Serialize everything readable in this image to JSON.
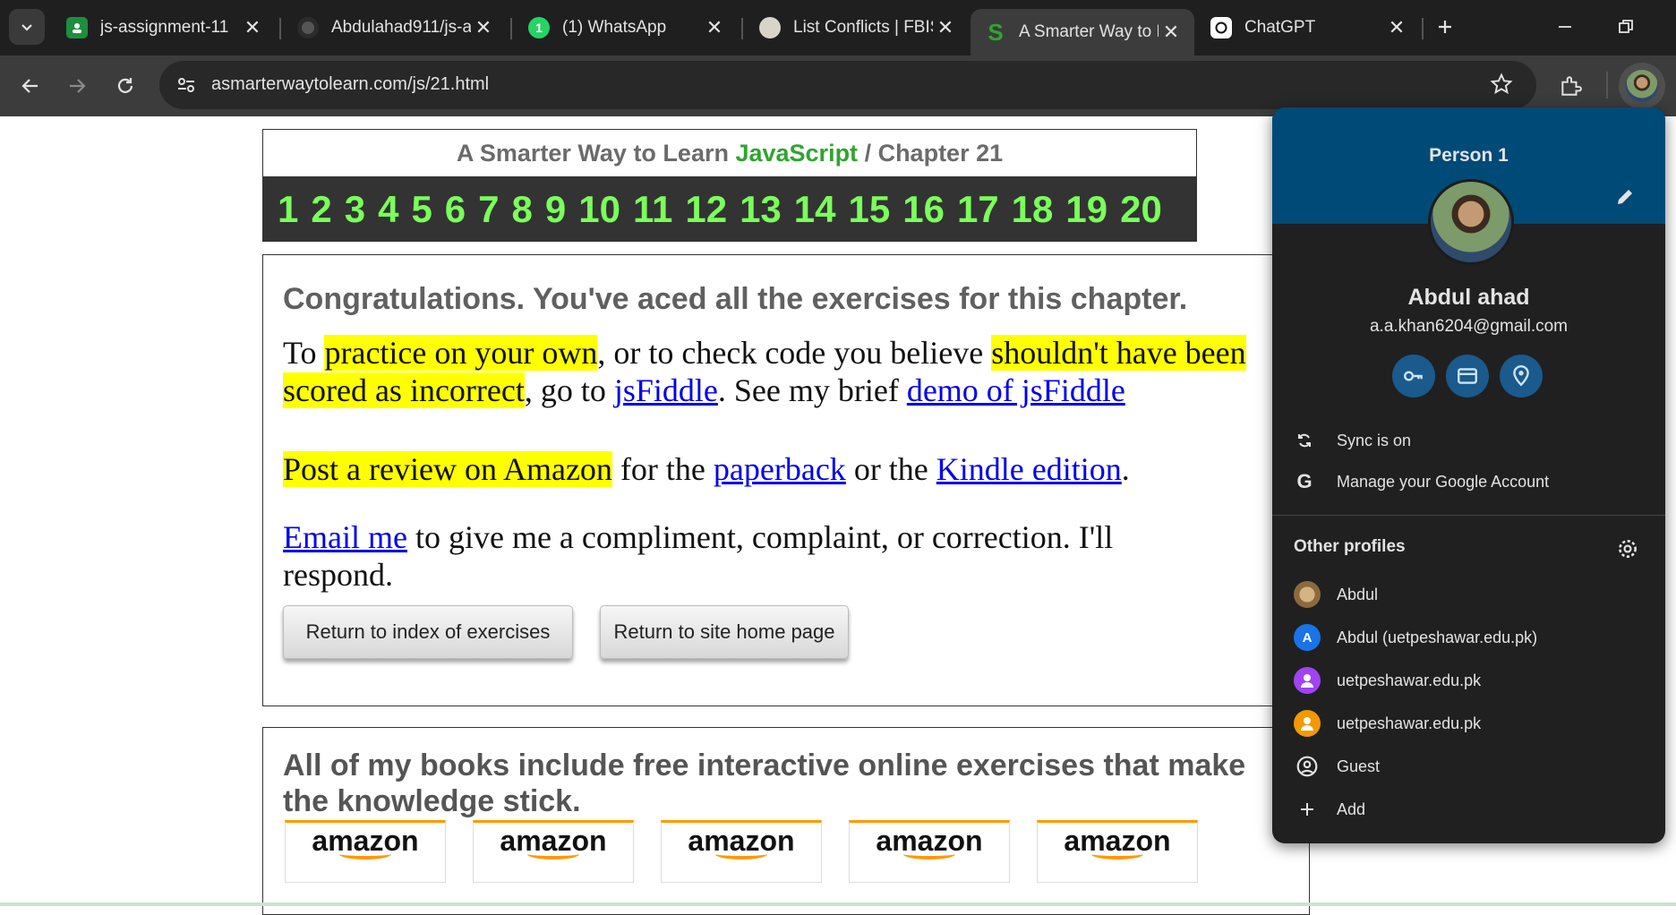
{
  "tabs": [
    {
      "title": "js-assignment-11",
      "icon": "classroom-icon",
      "color": "#1e8e3e"
    },
    {
      "title": "Abdulahad911/js-a",
      "icon": "github-icon",
      "color": "#2b2b2b"
    },
    {
      "title": "(1) WhatsApp",
      "icon": "whatsapp-icon",
      "color": "#25d366"
    },
    {
      "title": "List Conflicts | FBIS",
      "icon": "fbis-icon",
      "color": "#d9d4c8"
    },
    {
      "title": "A Smarter Way to L",
      "icon": "smarterway-icon",
      "color": "#2fa52f"
    },
    {
      "title": "ChatGPT",
      "icon": "chatgpt-icon",
      "color": "#ffffff"
    }
  ],
  "toolbar": {
    "url": "asmarterwaytolearn.com/js/21.html"
  },
  "page": {
    "header_prefix": "A Smarter Way to Learn ",
    "header_js": "JavaScript",
    "header_suffix": " / Chapter 21",
    "chapters": [
      "1",
      "2",
      "3",
      "4",
      "5",
      "6",
      "7",
      "8",
      "9",
      "10",
      "11",
      "12",
      "13",
      "14",
      "15",
      "16",
      "17",
      "18",
      "19",
      "20"
    ],
    "congrats": "Congratulations. You've aced all the exercises for this chapter.",
    "p1_a": "To ",
    "p1_hl1": "practice on your own",
    "p1_b": ", or to check code you believe ",
    "p1_hl2": "shouldn't have been scored as incorrect",
    "p1_c": ", go to ",
    "p1_link1": "jsFiddle",
    "p1_d": ". See my brief ",
    "p1_link2": "demo of jsFiddle",
    "p2_hl": "Post a review on Amazon",
    "p2_a": " for the ",
    "p2_link1": "paperback",
    "p2_b": " or the ",
    "p2_link2": "Kindle edition",
    "p2_c": ".",
    "p3_link": "Email me",
    "p3_a": " to give me a compliment, complaint, or correction. I'll respond.",
    "btn_index": "Return to index of exercises",
    "btn_home": "Return to site home page",
    "books_title": " All of my books include free interactive online exercises that make the knowledge stick.",
    "amazon_word": "amazon"
  },
  "profile": {
    "title": "Person 1",
    "name": "Abdul ahad",
    "email": "a.a.khan6204@gmail.com",
    "sync": "Sync is on",
    "manage": "Manage your Google Account",
    "other_profiles": "Other profiles",
    "profiles": [
      {
        "label": "Abdul",
        "avatar": "photo-avatar",
        "color": "#a0825a",
        "letter": ""
      },
      {
        "label": "Abdul (uetpeshawar.edu.pk)",
        "avatar": "letter-avatar",
        "color": "#1a73e8",
        "letter": "A"
      },
      {
        "label": "uetpeshawar.edu.pk",
        "avatar": "person-avatar",
        "color": "#a142f4",
        "letter": ""
      },
      {
        "label": "uetpeshawar.edu.pk",
        "avatar": "person-avatar",
        "color": "#f29900",
        "letter": ""
      }
    ],
    "guest": "Guest",
    "add": "Add"
  }
}
